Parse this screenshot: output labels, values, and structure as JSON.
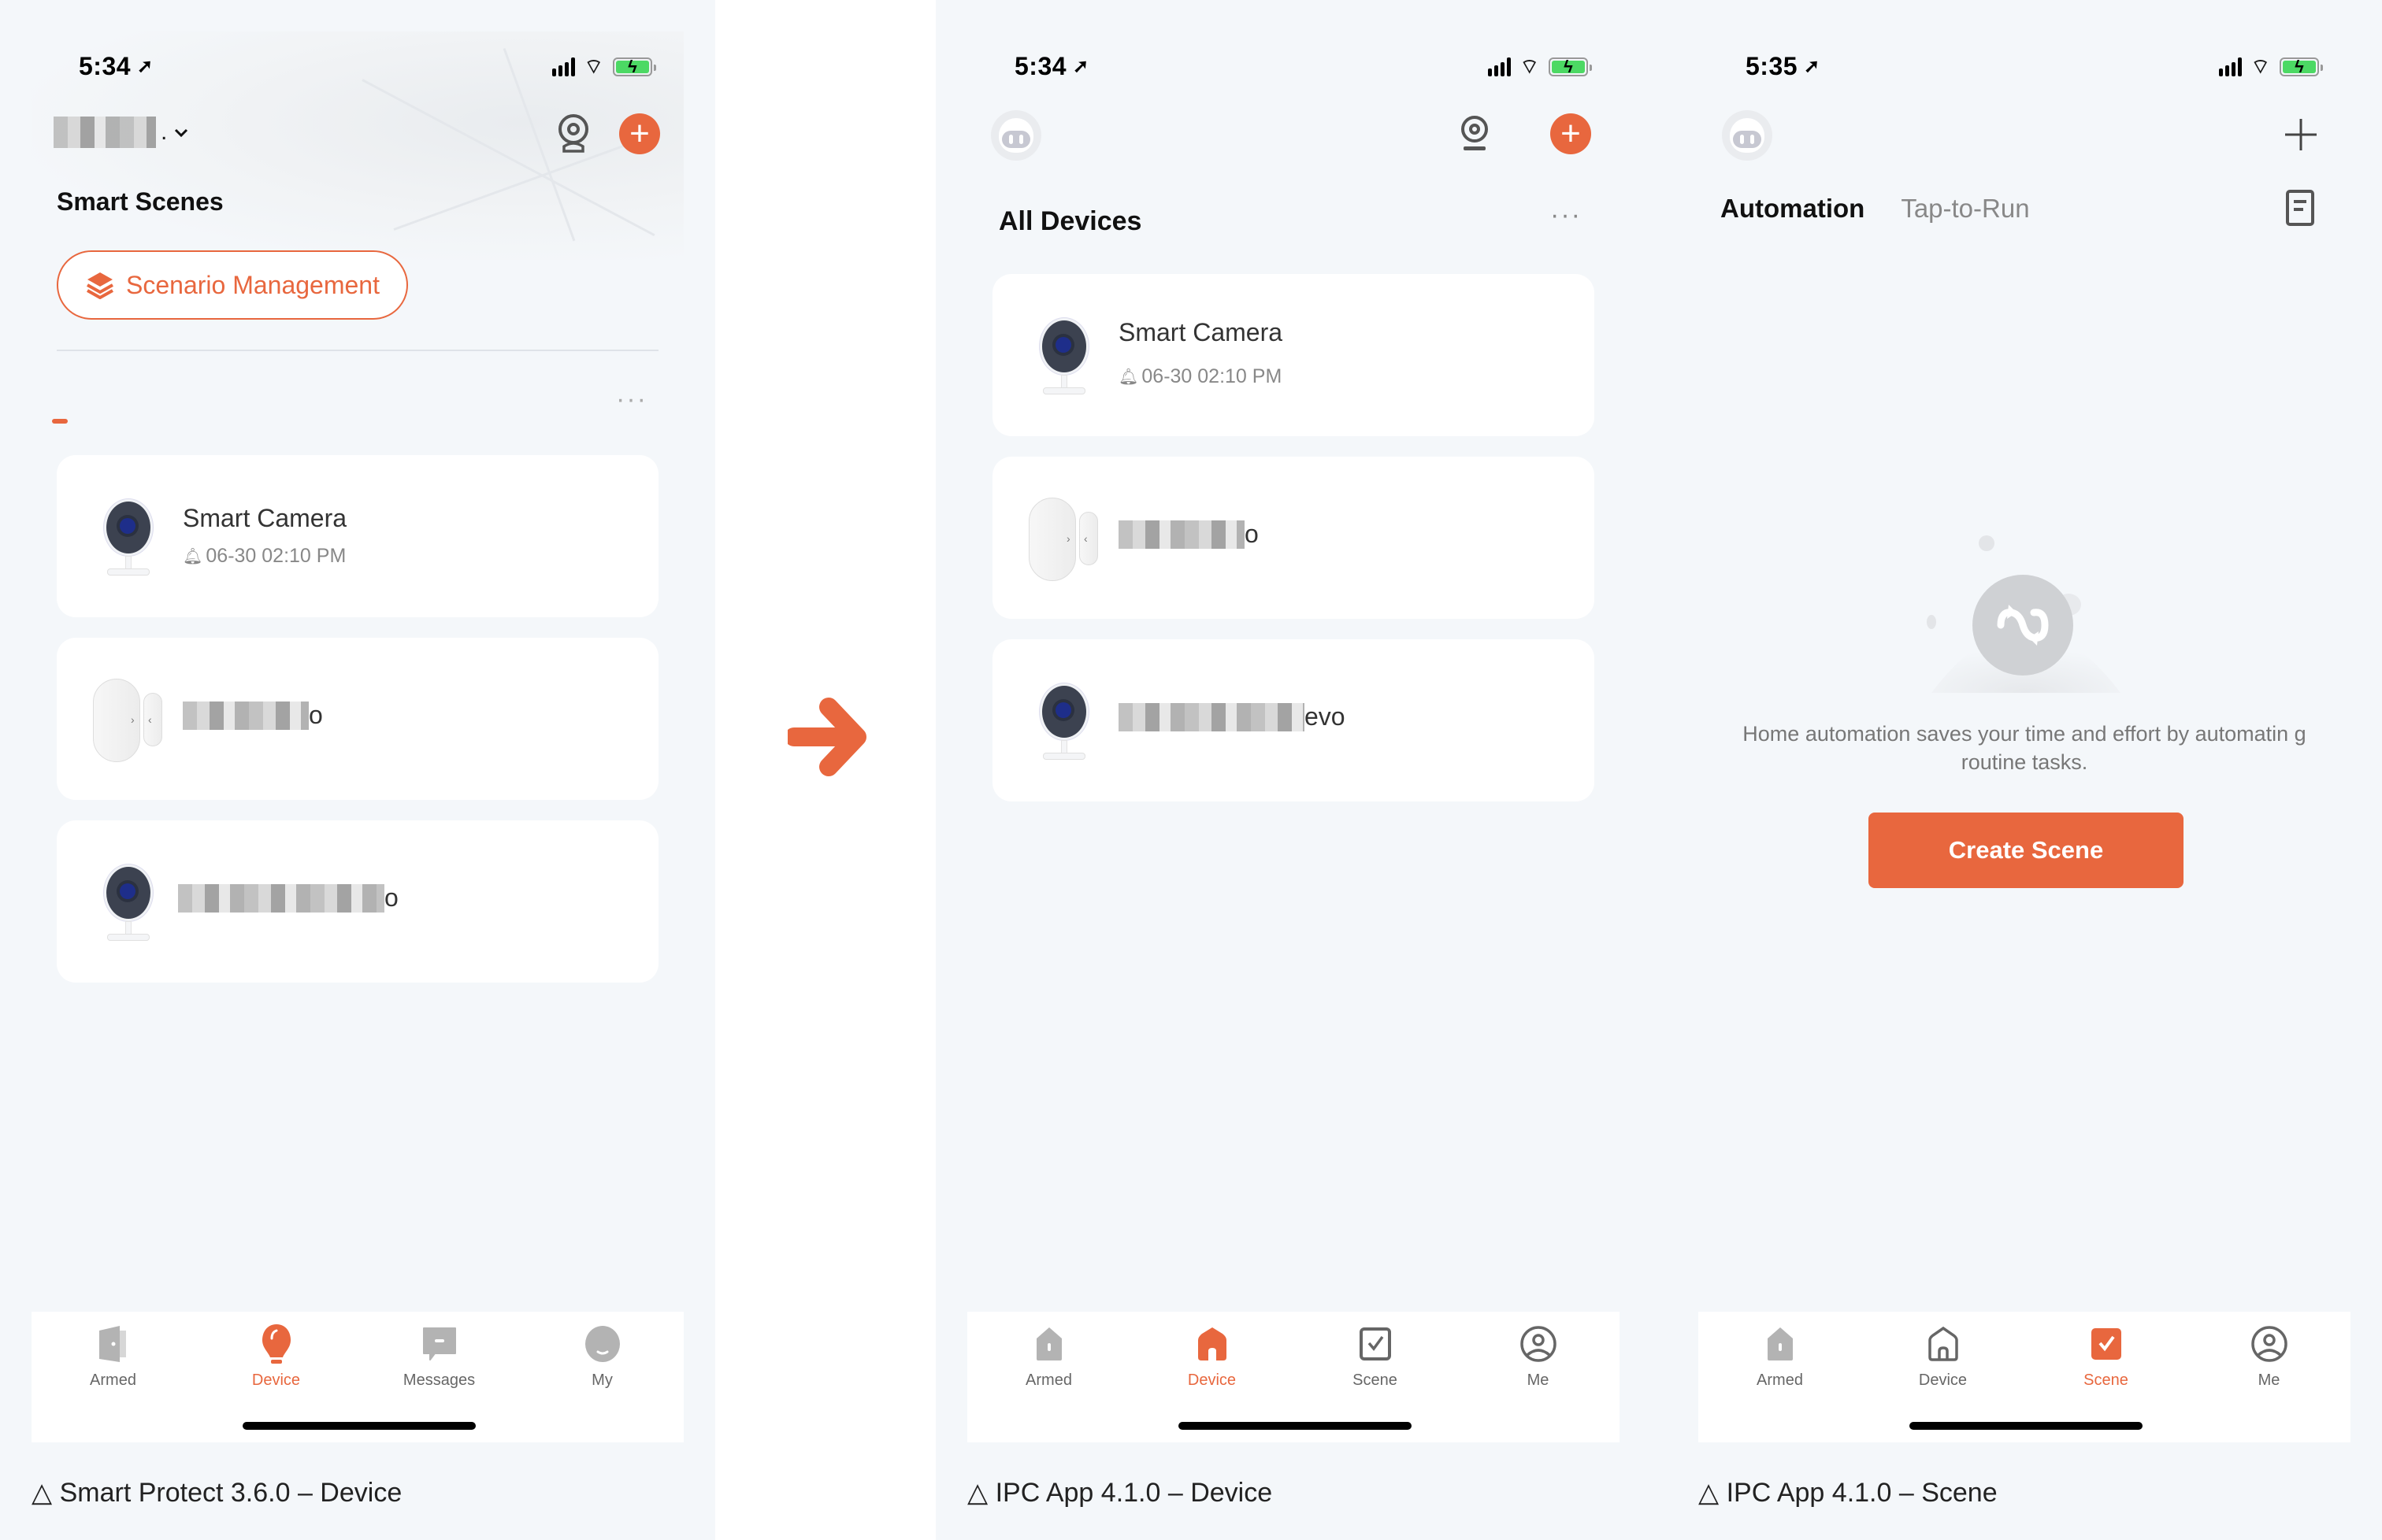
{
  "colors": {
    "accent": "#e8673e",
    "background": "#f4f7fa",
    "card": "#ffffff",
    "battery": "#4cd964"
  },
  "transition_arrow": {
    "icon": "arrow-right-icon"
  },
  "screens": [
    {
      "id": "smart-protect",
      "status": {
        "time": "5:34"
      },
      "header": {
        "home_name_dot": ".",
        "icons": [
          "camera-icon",
          "add-icon"
        ]
      },
      "section_title": "Smart Scenes",
      "scenario_button": "Scenario Management",
      "more_label": "···",
      "devices": [
        {
          "name": "Smart Camera",
          "sub": "06-30 02:10 PM",
          "type": "camera"
        },
        {
          "name": "",
          "suffix": "o",
          "type": "door-sensor",
          "blurred": true
        },
        {
          "name": "",
          "suffix": "o",
          "type": "camera",
          "blurred": true
        }
      ],
      "tabs": [
        {
          "label": "Armed",
          "icon": "shield-door-icon",
          "active": false
        },
        {
          "label": "Device",
          "icon": "bulb-icon",
          "active": true
        },
        {
          "label": "Messages",
          "icon": "message-icon",
          "active": false
        },
        {
          "label": "My",
          "icon": "profile-icon",
          "active": false
        }
      ],
      "caption": "△ Smart Protect 3.6.0 – Device"
    },
    {
      "id": "ipc-device",
      "status": {
        "time": "5:34"
      },
      "section_title": "All Devices",
      "more_label": "···",
      "devices": [
        {
          "name": "Smart Camera",
          "sub": "06-30 02:10 PM",
          "type": "camera"
        },
        {
          "name": "",
          "suffix": "o",
          "type": "door-sensor",
          "blurred": true
        },
        {
          "name": "",
          "suffix": "evo",
          "type": "camera",
          "blurred": true
        }
      ],
      "tabs": [
        {
          "label": "Armed",
          "icon": "armed-house-icon",
          "active": false
        },
        {
          "label": "Device",
          "icon": "home-icon",
          "active": true
        },
        {
          "label": "Scene",
          "icon": "checkbox-icon",
          "active": false
        },
        {
          "label": "Me",
          "icon": "profile-icon",
          "active": false
        }
      ],
      "caption": "△ IPC App 4.1.0 – Device"
    },
    {
      "id": "ipc-scene",
      "status": {
        "time": "5:35"
      },
      "scene_tabs": [
        {
          "label": "Automation",
          "active": true
        },
        {
          "label": "Tap-to-Run",
          "active": false
        }
      ],
      "empty_message": "Home automation saves your time and effort by automatin g routine tasks.",
      "create_button": "Create Scene",
      "tabs": [
        {
          "label": "Armed",
          "icon": "armed-house-icon",
          "active": false
        },
        {
          "label": "Device",
          "icon": "home-icon",
          "active": false
        },
        {
          "label": "Scene",
          "icon": "checkbox-icon",
          "active": true
        },
        {
          "label": "Me",
          "icon": "profile-icon",
          "active": false
        }
      ],
      "caption": "△ IPC App 4.1.0 – Scene"
    }
  ]
}
